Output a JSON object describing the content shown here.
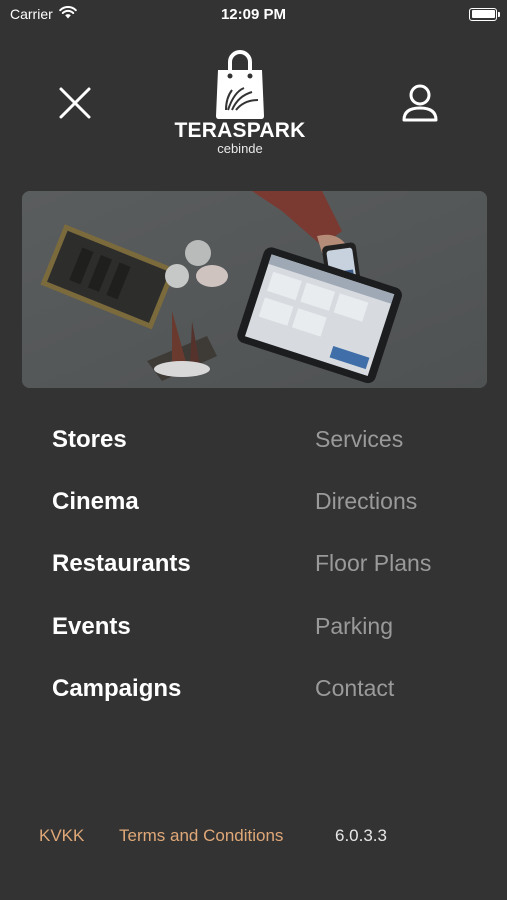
{
  "status_bar": {
    "carrier": "Carrier",
    "time": "12:09 PM"
  },
  "logo": {
    "name": "TERASPARK",
    "sub": "cebinde"
  },
  "menu": {
    "primary": [
      "Stores",
      "Cinema",
      "Restaurants",
      "Events",
      "Campaigns"
    ],
    "secondary": [
      "Services",
      "Directions",
      "Floor Plans",
      "Parking",
      "Contact"
    ]
  },
  "footer": {
    "kvkk": "KVKK",
    "terms": "Terms and Conditions",
    "version": "6.0.3.3"
  },
  "icons": {
    "close": "close-icon",
    "profile": "user-icon",
    "wifi": "wifi-icon",
    "battery": "battery-icon",
    "bag": "shopping-bag-icon"
  },
  "colors": {
    "background": "#333333",
    "footer_link": "#e0a878",
    "secondary_text": "#9a9a9a"
  }
}
